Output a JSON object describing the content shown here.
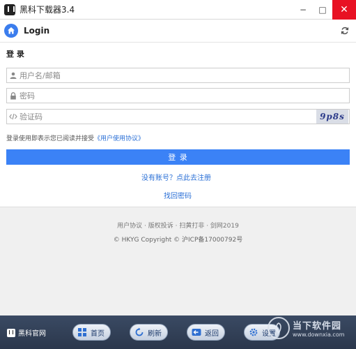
{
  "window": {
    "title": "黑科下载器3.4",
    "minimize": "−",
    "maximize": "□",
    "close": "✕"
  },
  "header": {
    "title": "Login",
    "home_icon": "home-icon",
    "refresh_icon": "refresh-icon"
  },
  "form": {
    "section_title": "登 录",
    "username": {
      "placeholder": "用户名/邮箱",
      "value": ""
    },
    "password": {
      "placeholder": "密码",
      "value": ""
    },
    "captcha": {
      "placeholder": "验证码",
      "value": "",
      "image_text": "9p8s"
    },
    "agreement_prefix": "登录使用即表示您已阅读并接受",
    "agreement_link": "《用户使用协议》",
    "login_button": "登 录",
    "register_link": "没有账号？点此去注册",
    "recover_link": "找回密码"
  },
  "footer": {
    "links": "用户协议 · 版权投诉 · 扫黄打非 · 剑网2019",
    "copyright": "© HKYG Copyright © 沪ICP备17000792号"
  },
  "bottombar": {
    "brand": "黑科官网",
    "buttons": [
      {
        "label": "首页",
        "icon": "grid-icon"
      },
      {
        "label": "刷新",
        "icon": "refresh-icon"
      },
      {
        "label": "返回",
        "icon": "back-arrow-icon"
      },
      {
        "label": "设置",
        "icon": "gear-icon"
      }
    ]
  },
  "watermark": {
    "cn": "当下软件园",
    "en": "www.downxia.com"
  },
  "colors": {
    "accent": "#3b82f6",
    "link": "#2a6fd6",
    "close": "#e81123",
    "bottombar": "#2f3b52"
  }
}
